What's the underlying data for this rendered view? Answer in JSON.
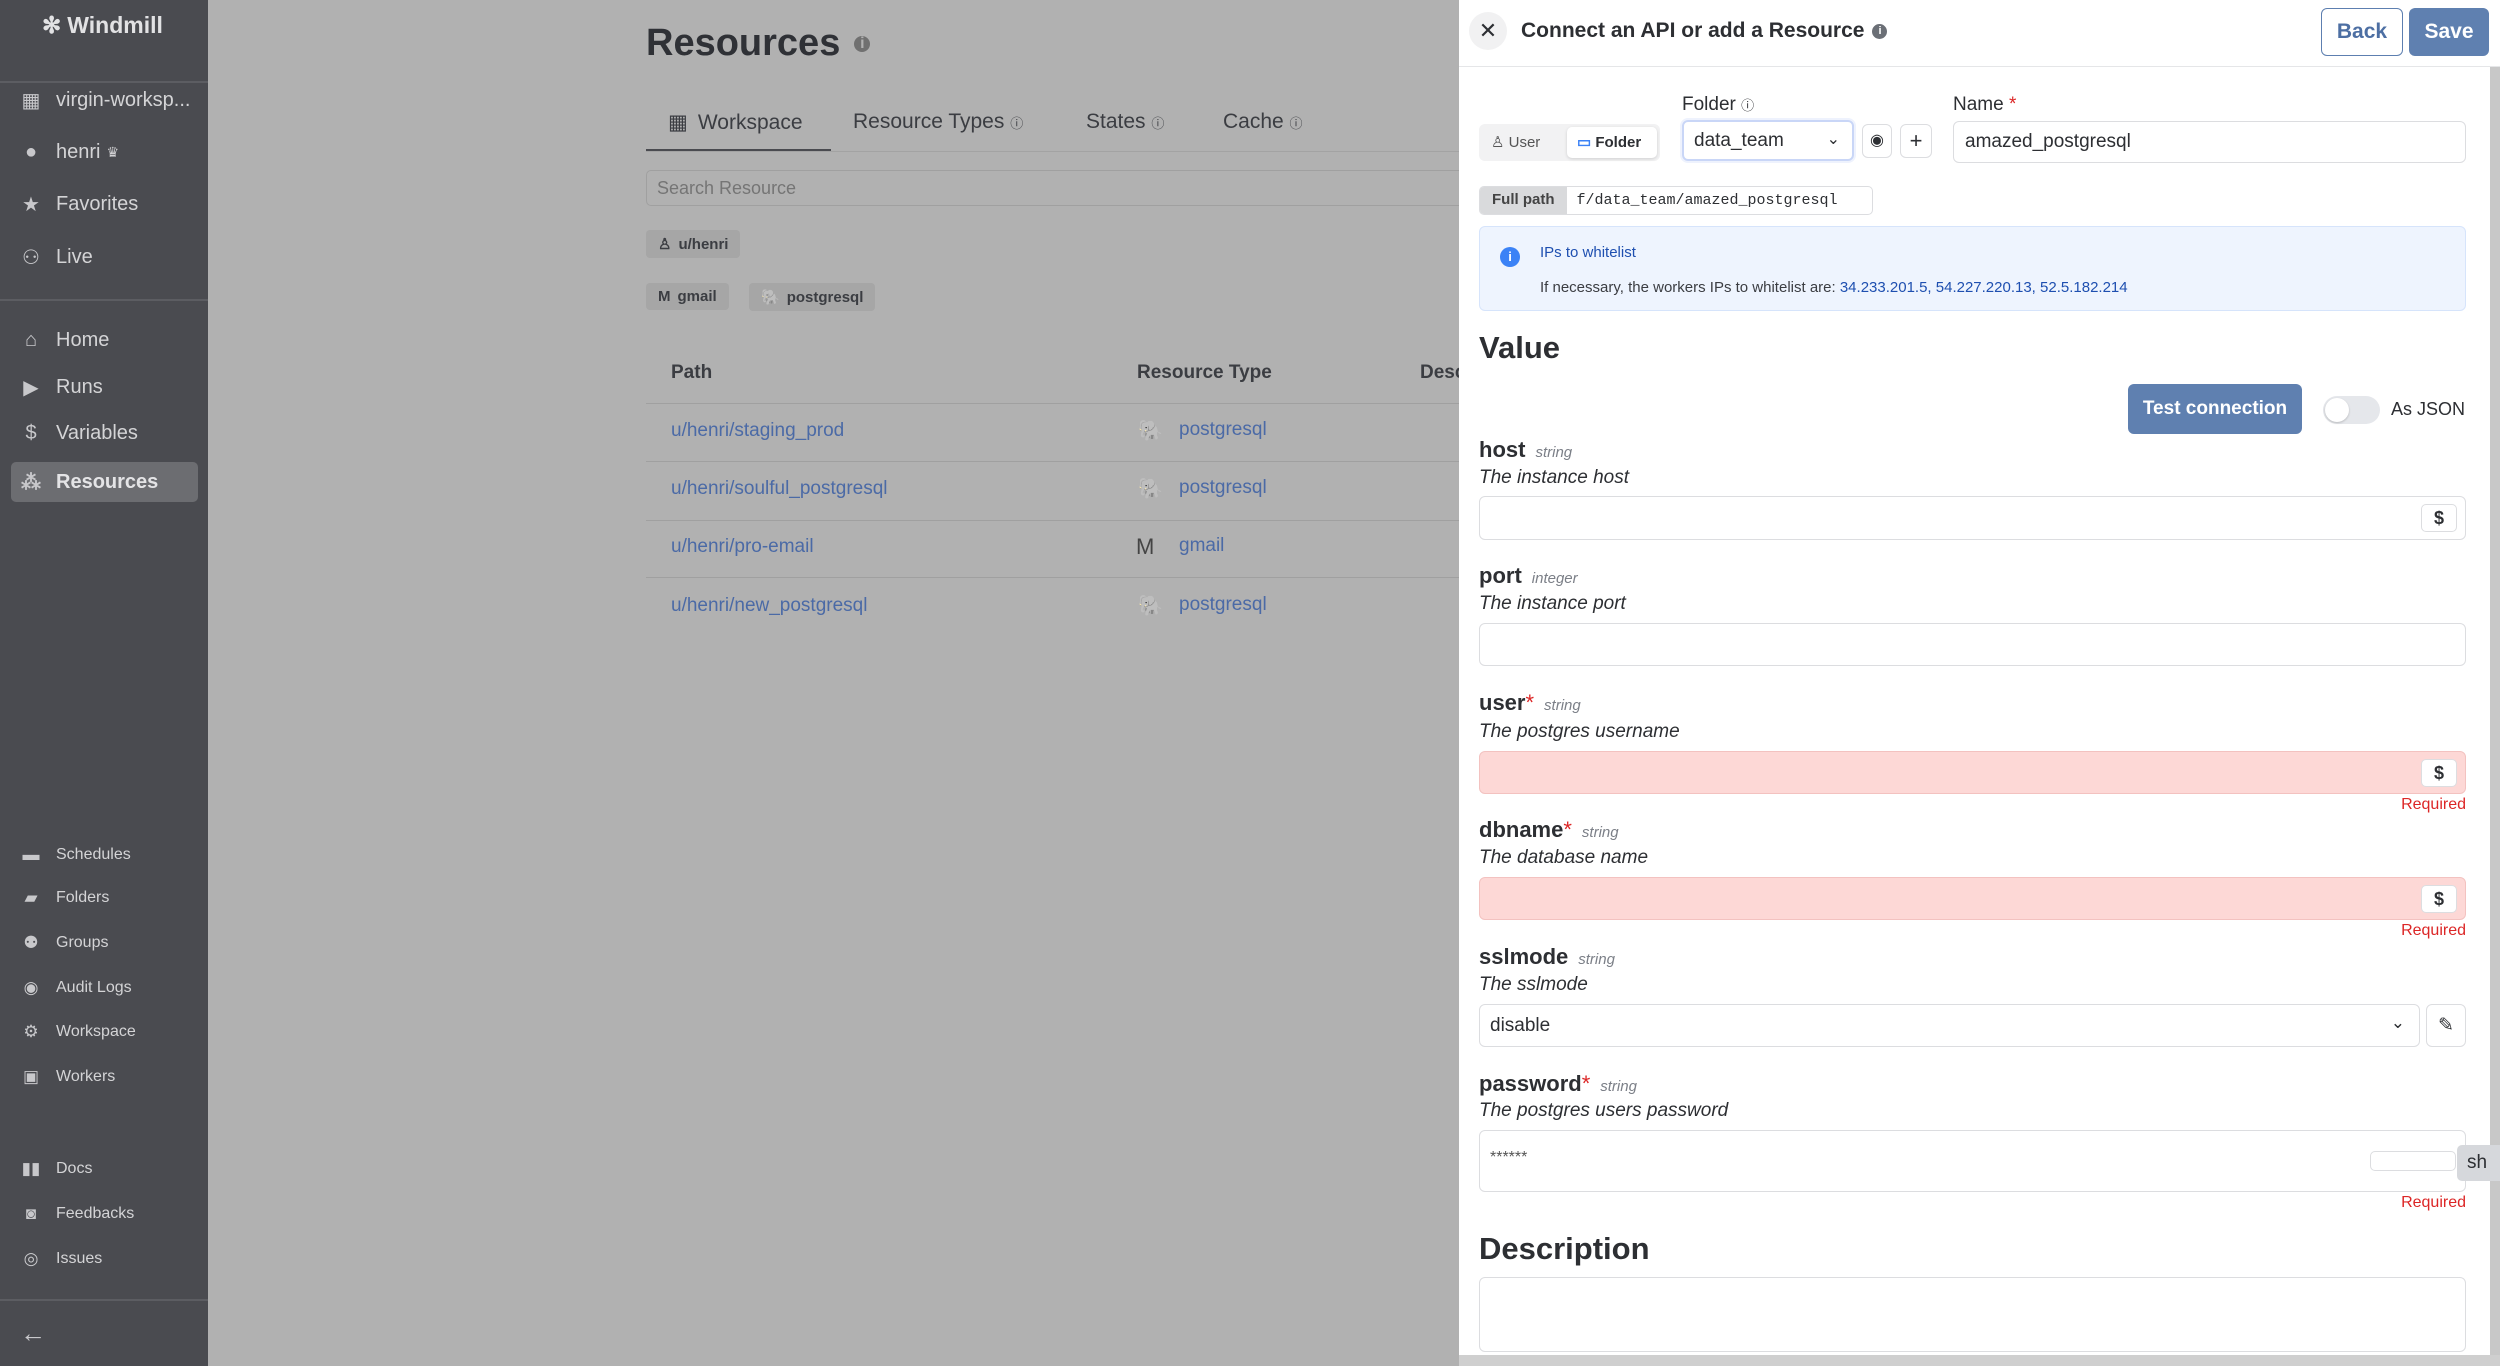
{
  "sidebar": {
    "brand": "Windmill",
    "workspace": "virgin-worksp...",
    "user": "henri",
    "top_items": [
      {
        "label": "Favorites",
        "icon": "star-icon"
      },
      {
        "label": "Live",
        "icon": "users-icon"
      }
    ],
    "nav_items": [
      {
        "label": "Home",
        "icon": "home-icon"
      },
      {
        "label": "Runs",
        "icon": "play-icon"
      },
      {
        "label": "Variables",
        "icon": "dollar-icon"
      },
      {
        "label": "Resources",
        "icon": "boxes-icon",
        "active": true
      }
    ],
    "admin_items": [
      {
        "label": "Schedules"
      },
      {
        "label": "Folders"
      },
      {
        "label": "Groups"
      },
      {
        "label": "Audit Logs"
      },
      {
        "label": "Workspace"
      },
      {
        "label": "Workers"
      }
    ],
    "help_items": [
      {
        "label": "Docs"
      },
      {
        "label": "Feedbacks"
      },
      {
        "label": "Issues"
      }
    ]
  },
  "main": {
    "title": "Resources",
    "tabs": [
      {
        "label": "Workspace",
        "active": true
      },
      {
        "label": "Resource Types"
      },
      {
        "label": "States"
      },
      {
        "label": "Cache"
      }
    ],
    "search_placeholder": "Search Resource",
    "owner_filters": [
      "u/henri"
    ],
    "type_filters": [
      "gmail",
      "postgresql"
    ],
    "table": {
      "headers": [
        "Path",
        "Resource Type",
        "Desc"
      ],
      "rows": [
        {
          "path": "u/henri/staging_prod",
          "type": "postgresql"
        },
        {
          "path": "u/henri/soulful_postgresql",
          "type": "postgresql"
        },
        {
          "path": "u/henri/pro-email",
          "type": "gmail"
        },
        {
          "path": "u/henri/new_postgresql",
          "type": "postgresql"
        }
      ]
    }
  },
  "drawer": {
    "title": "Connect an API or add a Resource",
    "back_label": "Back",
    "save_label": "Save",
    "owner_toggle": {
      "user": "User",
      "folder": "Folder",
      "selected": "Folder"
    },
    "folder_label": "Folder",
    "folder_value": "data_team",
    "name_label": "Name",
    "name_value": "amazed_postgresql",
    "full_path_label": "Full path",
    "full_path": "f/data_team/amazed_postgresql",
    "info": {
      "title": "IPs to whitelist",
      "text": "If necessary, the workers IPs to whitelist are:",
      "ips": "34.233.201.5, 54.227.220.13, 52.5.182.214"
    },
    "value_heading": "Value",
    "test_connection": "Test connection",
    "as_json": "As JSON",
    "as_json_on": false,
    "fields": {
      "host": {
        "name": "host",
        "type": "string",
        "desc": "The instance host",
        "value": ""
      },
      "port": {
        "name": "port",
        "type": "integer",
        "desc": "The instance port",
        "value": ""
      },
      "user": {
        "name": "user",
        "type": "string",
        "desc": "The postgres username",
        "value": "",
        "error": "Required"
      },
      "dbname": {
        "name": "dbname",
        "type": "string",
        "desc": "The database name",
        "value": "",
        "error": "Required"
      },
      "sslmode": {
        "name": "sslmode",
        "type": "string",
        "desc": "The sslmode",
        "value": "disable"
      },
      "password": {
        "name": "password",
        "type": "string",
        "desc": "The postgres users password",
        "value": "******",
        "error": "Required",
        "show": "sh"
      }
    },
    "required_mark": "*",
    "dollar": "$",
    "description_heading": "Description",
    "description_value": ""
  }
}
